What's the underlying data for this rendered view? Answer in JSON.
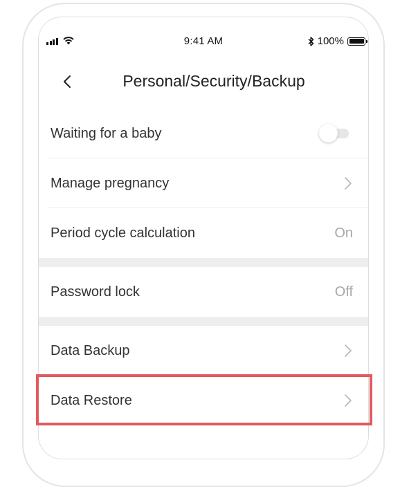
{
  "status_bar": {
    "time": "9:41 AM",
    "battery_text": "100%",
    "icons": [
      "cellular-signal-icon",
      "wifi-icon",
      "bluetooth-icon",
      "battery-icon"
    ]
  },
  "nav": {
    "title": "Personal/Security/Backup",
    "back_icon": "chevron-left-icon"
  },
  "settings": {
    "waiting_for_baby": {
      "label": "Waiting for a baby",
      "toggle_state": "off"
    },
    "manage_pregnancy": {
      "label": "Manage pregnancy"
    },
    "period_cycle": {
      "label": "Period cycle calculation",
      "value": "On"
    },
    "password_lock": {
      "label": "Password lock",
      "value": "Off"
    },
    "data_backup": {
      "label": "Data Backup"
    },
    "data_restore": {
      "label": "Data Restore"
    }
  },
  "colors": {
    "highlight": "#e05a5e",
    "section_gap": "#eeeeee",
    "value_text": "#a8a8a8"
  }
}
